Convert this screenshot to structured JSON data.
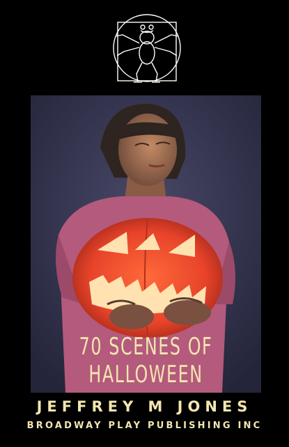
{
  "cover": {
    "title_line1": "70 SCENES OF",
    "title_line2": "HALLOWEEN",
    "author": "JEFFREY M JONES",
    "publisher": "BROADWAY PLAY PUBLISHING INC"
  },
  "icons": {
    "logo": "vitruvian-frog-icon",
    "illustration": "girl-holding-jack-o-lantern-illustration"
  },
  "colors": {
    "background": "#000000",
    "text": "#f3e6b0",
    "pumpkin": "#e8432a",
    "shirt": "#b45a7c"
  }
}
